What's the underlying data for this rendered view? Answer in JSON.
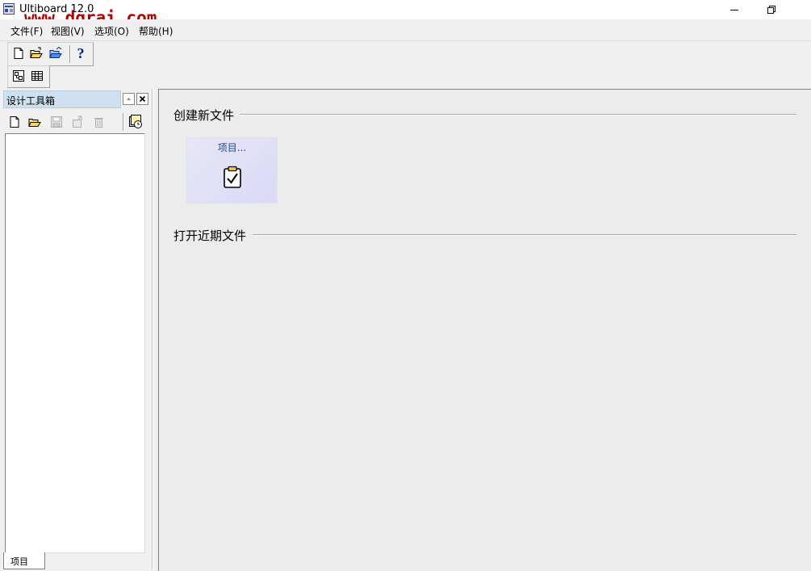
{
  "window": {
    "title": "Ultiboard 12.0",
    "watermark": "www.dgrai.com"
  },
  "menu": {
    "items": [
      {
        "label": "文件(F)"
      },
      {
        "label": "视图(V)"
      },
      {
        "label": "选项(O)"
      },
      {
        "label": "帮助(H)"
      }
    ]
  },
  "toolbar": {
    "buttons": [
      "new-file-icon",
      "open-file-icon",
      "open-folder-icon",
      "help-icon"
    ],
    "help_label": "?"
  },
  "toolbar2": {
    "buttons": [
      "design-view-icon",
      "spreadsheet-view-icon"
    ]
  },
  "left_panel": {
    "title": "设计工具箱",
    "tab_label": "项目",
    "tools": [
      "new-file-icon",
      "open-file-icon",
      "save-icon",
      "export-icon",
      "delete-icon",
      "recent-files-icon"
    ]
  },
  "main": {
    "create_section_title": "创建新文件",
    "project_tile_label": "项目...",
    "recent_section_title": "打开近期文件"
  },
  "colors": {
    "accent": "#1a4ca0",
    "watermark": "#b40000",
    "panel_title_bg": "#cfe0f0",
    "tile_bg": "#d9d9f5"
  }
}
